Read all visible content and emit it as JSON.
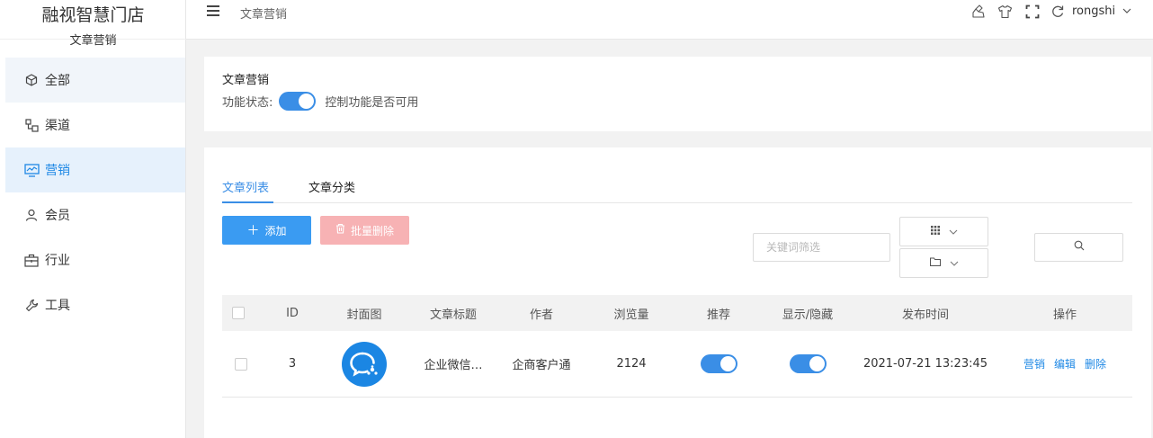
{
  "brand": {
    "title": "融视智慧门店",
    "subtitle": "文章营销"
  },
  "sidebar": {
    "items": [
      {
        "label": "全部",
        "icon": "cube-icon"
      },
      {
        "label": "渠道",
        "icon": "channel-icon"
      },
      {
        "label": "营销",
        "icon": "chart-monitor-icon"
      },
      {
        "label": "会员",
        "icon": "user-icon"
      },
      {
        "label": "行业",
        "icon": "briefcase-icon"
      },
      {
        "label": "工具",
        "icon": "wrench-icon"
      }
    ],
    "active_index": 2
  },
  "header": {
    "breadcrumb": "文章营销",
    "username": "rongshi",
    "icons": [
      "brush-icon",
      "shirt-icon",
      "fullscreen-icon",
      "refresh-icon"
    ]
  },
  "feature": {
    "title": "文章营销",
    "status_label": "功能状态:",
    "status_on": true,
    "status_desc": "控制功能是否可用"
  },
  "tabs": [
    {
      "label": "文章列表",
      "active": true
    },
    {
      "label": "文章分类",
      "active": false
    }
  ],
  "toolbar": {
    "add_label": "添加",
    "batch_delete_label": "批量删除",
    "keyword_placeholder": "关键词筛选"
  },
  "table": {
    "headers": [
      "ID",
      "封面图",
      "文章标题",
      "作者",
      "浏览量",
      "推荐",
      "显示/隐藏",
      "发布时间",
      "操作"
    ],
    "rows": [
      {
        "id": "3",
        "title": "企业微信…",
        "author": "企商客户通",
        "views": "2124",
        "recommend": true,
        "visible": true,
        "published": "2021-07-21 13:23:45",
        "actions": [
          "营销",
          "编辑",
          "删除"
        ]
      }
    ]
  },
  "colors": {
    "primary": "#3a8ee6",
    "add_button": "#3a9bf2",
    "delete_button_disabled": "#f7b2b4",
    "active_nav_bg": "#e6f1fc"
  }
}
